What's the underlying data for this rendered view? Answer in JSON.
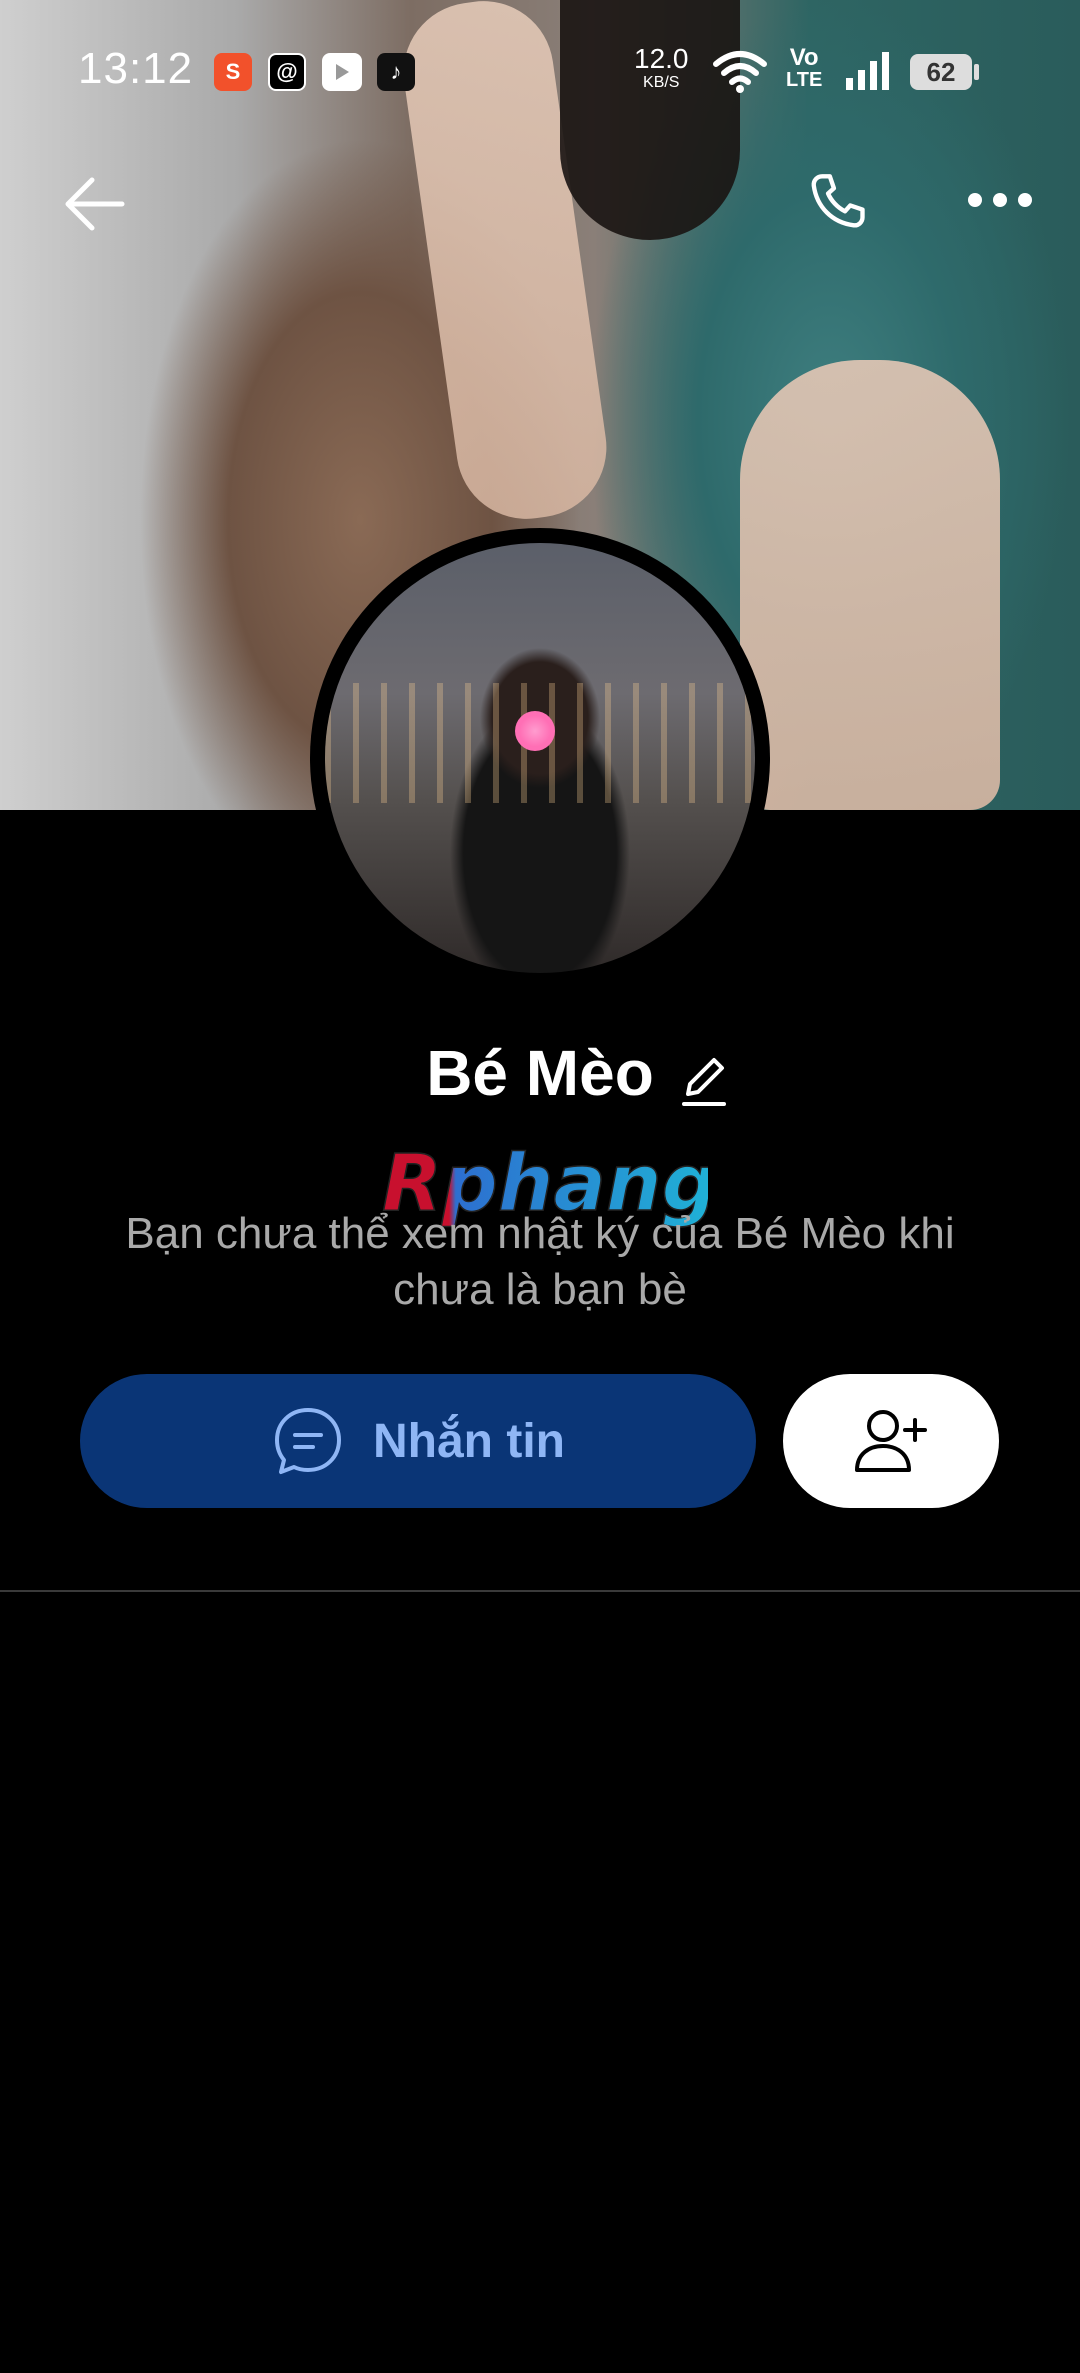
{
  "status_bar": {
    "time": "13:12",
    "net_speed": "12.0",
    "net_unit": "KB/S",
    "volte_top": "Vo",
    "volte_bottom": "LTE",
    "battery": "62",
    "apps": [
      "shopee-icon",
      "threads-icon",
      "youtube-icon",
      "tiktok-icon"
    ]
  },
  "profile": {
    "name": "Bé Mèo",
    "notice": "Bạn chưa thể xem nhật ký của Bé Mèo khi chưa là bạn bè"
  },
  "watermark": {
    "text": "Rphang"
  },
  "actions": {
    "message_label": "Nhắn tin"
  },
  "colors": {
    "background": "#000000",
    "message_button": "#0a3576",
    "message_text": "#8fb6f5",
    "notice_text": "#a9a9a9"
  },
  "icons": [
    "back-arrow-icon",
    "phone-icon",
    "more-icon",
    "edit-icon",
    "chat-icon",
    "add-friend-icon"
  ]
}
